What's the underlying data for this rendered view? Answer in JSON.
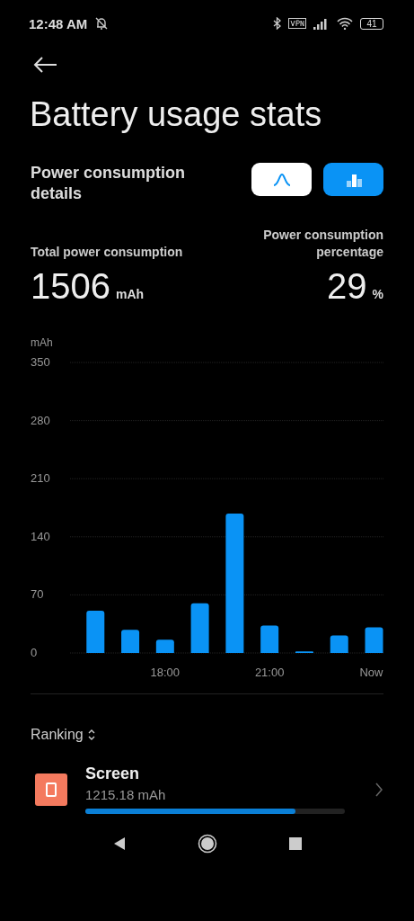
{
  "status_bar": {
    "time": "12:48 AM",
    "battery": "41"
  },
  "title": "Battery usage stats",
  "details": {
    "heading": "Power consumption details",
    "view_modes": [
      {
        "kind": "line",
        "selected": false
      },
      {
        "kind": "bar",
        "selected": true
      }
    ]
  },
  "total": {
    "label": "Total power consumption",
    "value": "1506",
    "unit": "mAh"
  },
  "percentage": {
    "label": "Power consumption percentage",
    "value": "29",
    "unit": "%"
  },
  "chart": {
    "chart_data": {
      "type": "bar",
      "ylabel": "mAh",
      "categories": [
        null,
        null,
        "18:00",
        null,
        null,
        "21:00",
        null,
        null,
        "Now"
      ],
      "values": [
        51,
        28,
        16,
        60,
        168,
        33,
        2,
        21,
        31
      ],
      "ylim": [
        0,
        350
      ],
      "grid": true,
      "yticks": [
        0,
        70,
        140,
        210,
        280,
        350
      ],
      "color": "#0a93f5"
    }
  },
  "ranking": {
    "label": "Ranking",
    "items": [
      {
        "name": "Screen",
        "reading": "1215.18 mAh",
        "level": 0.81,
        "color": "#f47a5e"
      }
    ]
  }
}
